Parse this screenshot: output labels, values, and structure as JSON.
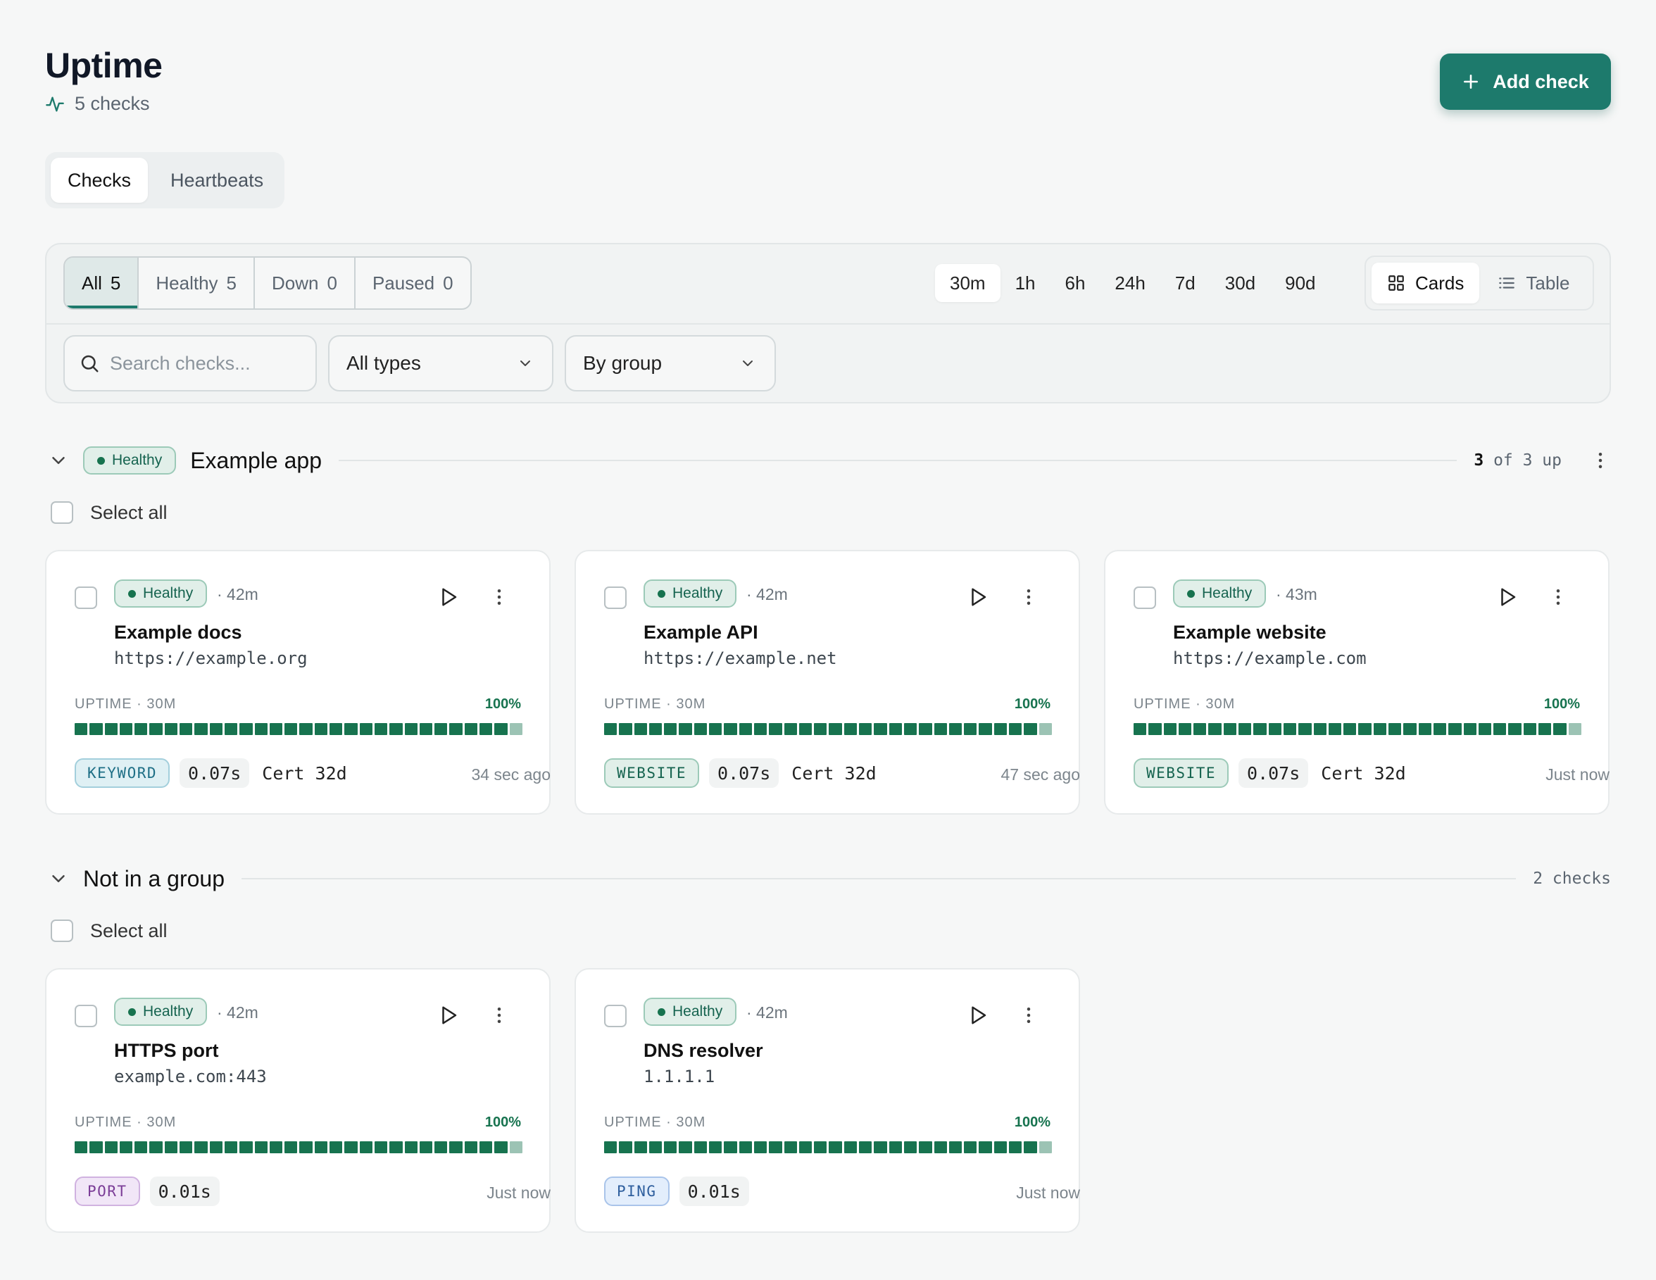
{
  "header": {
    "title": "Uptime",
    "subtitle": "5 checks",
    "add_label": "Add check"
  },
  "tabs": [
    {
      "label": "Checks",
      "active": true
    },
    {
      "label": "Heartbeats",
      "active": false
    }
  ],
  "filters": {
    "status": [
      {
        "label": "All",
        "count": "5",
        "active": true
      },
      {
        "label": "Healthy",
        "count": "5",
        "active": false
      },
      {
        "label": "Down",
        "count": "0",
        "active": false
      },
      {
        "label": "Paused",
        "count": "0",
        "active": false
      }
    ],
    "ranges": [
      "30m",
      "1h",
      "6h",
      "24h",
      "7d",
      "30d",
      "90d"
    ],
    "active_range": "30m",
    "views": [
      {
        "label": "Cards",
        "icon": "grid-icon",
        "active": true
      },
      {
        "label": "Table",
        "icon": "list-icon",
        "active": false
      }
    ],
    "search_placeholder": "Search checks...",
    "type_select": "All types",
    "group_select": "By group"
  },
  "colors": {
    "accent": "#1d7a6c",
    "healthy": "#17734f",
    "bar_last": "#9cc3b4"
  },
  "groups": [
    {
      "name": "Example app",
      "status": "Healthy",
      "summary_count": "3",
      "summary_text": "of 3 up",
      "select_all": "Select all",
      "cards": [
        {
          "status": "Healthy",
          "age": "· 42m",
          "name": "Example docs",
          "url": "https://example.org",
          "uptime_label": "UPTIME · 30M",
          "uptime": "100%",
          "uptime_fraction": 1.0,
          "type": "KEYWORD",
          "type_style": "keyword",
          "response": "0.07s",
          "cert": "Cert 32d",
          "last": "34 sec ago"
        },
        {
          "status": "Healthy",
          "age": "· 42m",
          "name": "Example API",
          "url": "https://example.net",
          "uptime_label": "UPTIME · 30M",
          "uptime": "100%",
          "uptime_fraction": 1.0,
          "type": "WEBSITE",
          "type_style": "website",
          "response": "0.07s",
          "cert": "Cert 32d",
          "last": "47 sec ago"
        },
        {
          "status": "Healthy",
          "age": "· 43m",
          "name": "Example website",
          "url": "https://example.com",
          "uptime_label": "UPTIME · 30M",
          "uptime": "100%",
          "uptime_fraction": 1.0,
          "type": "WEBSITE",
          "type_style": "website",
          "response": "0.07s",
          "cert": "Cert 32d",
          "last": "Just now"
        }
      ]
    },
    {
      "name": "Not in a group",
      "summary_count": "",
      "summary_text": "2 checks",
      "select_all": "Select all",
      "cards": [
        {
          "status": "Healthy",
          "age": "· 42m",
          "name": "HTTPS port",
          "url": "example.com:443",
          "uptime_label": "UPTIME · 30M",
          "uptime": "100%",
          "uptime_fraction": 1.0,
          "type": "PORT",
          "type_style": "port",
          "response": "0.01s",
          "cert": "",
          "last": "Just now"
        },
        {
          "status": "Healthy",
          "age": "· 42m",
          "name": "DNS resolver",
          "url": "1.1.1.1",
          "uptime_label": "UPTIME · 30M",
          "uptime": "100%",
          "uptime_fraction": 1.0,
          "type": "PING",
          "type_style": "ping",
          "response": "0.01s",
          "cert": "",
          "last": "Just now"
        }
      ]
    }
  ]
}
